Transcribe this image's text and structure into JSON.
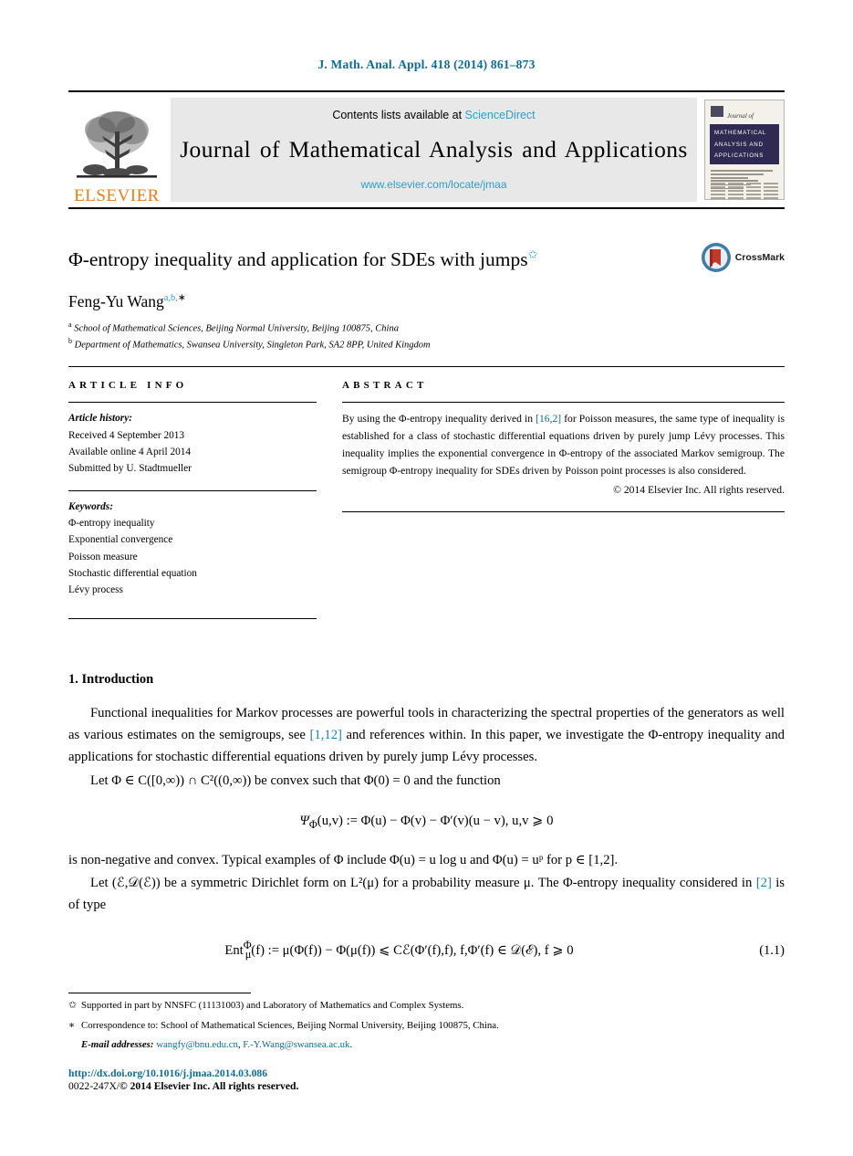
{
  "running_head": "J. Math. Anal. Appl. 418 (2014) 861–873",
  "masthead": {
    "contents_prefix": "Contents lists available at ",
    "sciencedirect": "ScienceDirect",
    "journal_title": "Journal of Mathematical Analysis and Applications",
    "journal_url": "www.elsevier.com/locate/jmaa",
    "publisher": "ELSEVIER",
    "cover": {
      "journal_of": "Journal of",
      "band_line1": "MATHEMATICAL",
      "band_line2": "ANALYSIS AND",
      "band_line3": "APPLICATIONS"
    },
    "link_color": "#2a9fd0"
  },
  "article": {
    "title": "Φ-entropy inequality and application for SDEs with jumps",
    "title_footnote_mark": "✩",
    "crossmark_label": "CrossMark",
    "author": "Feng-Yu Wang",
    "author_sup_a": "a",
    "author_sup_b": "b",
    "author_sup_star": "∗",
    "affiliations": [
      {
        "mark": "a",
        "text": "School of Mathematical Sciences, Beijing Normal University, Beijing 100875, China"
      },
      {
        "mark": "b",
        "text": "Department of Mathematics, Swansea University, Singleton Park, SA2 8PP, United Kingdom"
      }
    ]
  },
  "info": {
    "heading": "ARTICLE INFO",
    "history_label": "Article history:",
    "history": [
      "Received 4 September 2013",
      "Available online 4 April 2014",
      "Submitted by U. Stadtmueller"
    ],
    "keywords_label": "Keywords:",
    "keywords": [
      "Φ-entropy inequality",
      "Exponential convergence",
      "Poisson measure",
      "Stochastic differential equation",
      "Lévy process"
    ]
  },
  "abstract": {
    "heading": "ABSTRACT",
    "part1": "By using the Φ-entropy inequality derived in ",
    "ref1": "[16,2]",
    "part2": " for Poisson measures, the same type of inequality is established for a class of stochastic differential equations driven by purely jump Lévy processes. This inequality implies the exponential convergence in Φ-entropy of the associated Markov semigroup. The semigroup Φ-entropy inequality for SDEs driven by Poisson point processes is also considered.",
    "rights": "© 2014 Elsevier Inc. All rights reserved."
  },
  "body": {
    "section_number_title": "1. Introduction",
    "p1_a": "Functional inequalities for Markov processes are powerful tools in characterizing the spectral properties of the generators as well as various estimates on the semigroups, see ",
    "p1_ref": "[1,12]",
    "p1_b": " and references within. In this paper, we investigate the Φ-entropy inequality and applications for stochastic differential equations driven by purely jump Lévy processes.",
    "p2": "Let Φ ∈ C([0,∞)) ∩ C²((0,∞)) be convex such that Φ(0) = 0 and the function",
    "eq_psi": "Ψ",
    "eq_psi_sub": "Φ",
    "eq_psi_rest": "(u,v) := Φ(u) − Φ(v) − Φ′(v)(u − v),    u,v ⩾ 0",
    "p3": "is non-negative and convex. Typical examples of Φ include Φ(u) = u log u and Φ(u) = uᵖ for p ∈ [1,2].",
    "p4_a": "Let (ℰ,𝒟(ℰ)) be a symmetric Dirichlet form on L²(μ) for a probability measure μ. The Φ-entropy inequality considered in ",
    "p4_ref": "[2]",
    "p4_b": " is of type",
    "eq11_ent": "Ent",
    "eq11_sup": "Φ",
    "eq11_sub": "μ",
    "eq11_rest": "(f) := μ(Φ(f)) − Φ(μ(f)) ⩽ Cℰ(Φ′(f),f),    f,Φ′(f) ∈ 𝒟(ℰ), f ⩾ 0",
    "eq11_number": "(1.1)"
  },
  "footnotes": {
    "star_mark": "✩",
    "star_text": "Supported in part by NNSFC (11131003) and Laboratory of Mathematics and Complex Systems.",
    "corr_mark": "∗",
    "corr_text": "Correspondence to: School of Mathematical Sciences, Beijing Normal University, Beijing 100875, China.",
    "email_label": "E-mail addresses:",
    "email1": "wangfy@bnu.edu.cn",
    "email_sep": ", ",
    "email2": "F.-Y.Wang@swansea.ac.uk",
    "email_end": "."
  },
  "footer": {
    "doi": "http://dx.doi.org/10.1016/j.jmaa.2014.03.086",
    "issn_prefix": "0022-247X/",
    "issn_rest": "© 2014 Elsevier Inc. All rights reserved."
  }
}
